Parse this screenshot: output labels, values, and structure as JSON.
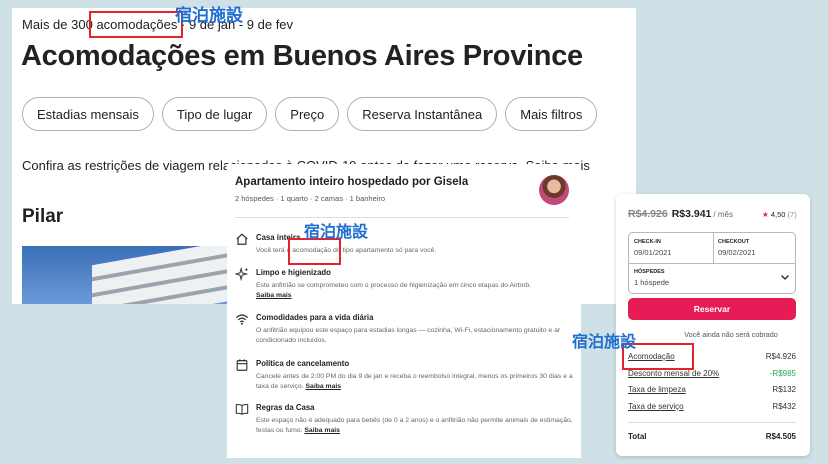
{
  "search": {
    "subtitle_prefix": "Mais de 300",
    "subtitle_word": "acomodações",
    "subtitle_dates": "9 de jan - 9 de fev",
    "title": "Acomodações em Buenos Aires Province",
    "filters": [
      "Estadias mensais",
      "Tipo de lugar",
      "Preço",
      "Reserva Instantânea",
      "Mais filtros"
    ],
    "notice": "Confira as restrições de viagem relacionadas à COVID-19 antes de fazer uma reserva. Saiba mais",
    "section": "Pilar"
  },
  "listing": {
    "title": "Apartamento inteiro hospedado por Gisela",
    "meta": "2 hóspedes · 1 quarto · 2 camas · 1 banheiro",
    "features": [
      {
        "icon": "home-icon",
        "title": "Casa inteira",
        "desc_before": "Você terá o",
        "desc_word": "acomodação",
        "desc_after": "do tipo apartamento só para você.",
        "link": ""
      },
      {
        "icon": "sparkle-icon",
        "title": "Limpo e higienizado",
        "desc": "Este anfitrião se comprometeu com o processo de higienização em cinco etapas do Airbnb.",
        "link": "Saiba mais"
      },
      {
        "icon": "wifi-icon",
        "title": "Comodidades para a vida diária",
        "desc": "O anfitrião equipou este espaço para estadias longas — cozinha, Wi-Fi, estacionamento gratuito e ar condicionado incluídos.",
        "link": ""
      },
      {
        "icon": "calendar-icon",
        "title": "Política de cancelamento",
        "desc": "Cancele antes de 2:00 PM do dia 9 de jan e receba o reembolso integral, menos os primeiros 30 dias e a taxa de serviço.",
        "link": "Saiba mais"
      },
      {
        "icon": "book-icon",
        "title": "Regras da Casa",
        "desc": "Este espaço não é adequado para bebês (de 0 a 2 anos) e o anfitrião não permite animais de estimação, festas ou fumo.",
        "link": "Saiba mais"
      }
    ]
  },
  "booking": {
    "price_old": "R$4.926",
    "price_new": "R$3.941",
    "per": "/ mês",
    "rating": "4,50",
    "reviews": "(7)",
    "checkin_label": "CHECK-IN",
    "checkin_value": "09/01/2021",
    "checkout_label": "CHECKOUT",
    "checkout_value": "09/02/2021",
    "guests_label": "HÓSPEDES",
    "guests_value": "1 hóspede",
    "reserve_label": "Reservar",
    "no_charge": "Você ainda não será cobrado",
    "fees": [
      {
        "label": "Acomodação",
        "value": "R$4.926"
      },
      {
        "label": "Desconto mensal de 20%",
        "value": "-R$985"
      },
      {
        "label": "Taxa de limpeza",
        "value": "R$132"
      },
      {
        "label": "Taxa de serviço",
        "value": "R$432"
      }
    ],
    "total_label": "Total",
    "total_value": "R$4.505",
    "accent": "#e51c56"
  },
  "annotations": {
    "label": "宿泊施設",
    "box_color": "#e3232b",
    "text_color": "#1f6fd1"
  }
}
